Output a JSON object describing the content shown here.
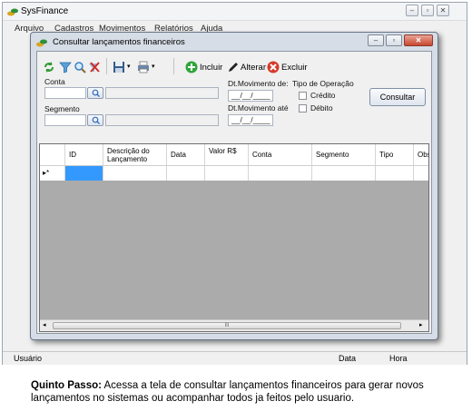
{
  "app": {
    "title": "SysFinance",
    "menu": [
      "Arquivo",
      "Cadastros",
      "Movimentos",
      "Relatórios",
      "Ajuda"
    ],
    "status": {
      "user": "Usuário",
      "date": "Data",
      "time": "Hora"
    }
  },
  "child": {
    "title": "Consultar lançamentos financeiros",
    "toolbar": {
      "incluir": "Incluir",
      "alterar": "Alterar",
      "excluir": "Excluir"
    },
    "filters": {
      "conta_label": "Conta",
      "segmento_label": "Segmento",
      "dt_de_label": "Dt.Movimento de:",
      "dt_ate_label": "Dt.Movimento até",
      "dt_de_value": "__/__/____",
      "dt_ate_value": "__/__/____",
      "tipo_label": "Tipo de Operação",
      "credito": "Crédito",
      "debito": "Débito",
      "consultar": "Consultar"
    },
    "grid": {
      "columns": [
        "ID",
        "Descrição do Lançamento",
        "Data",
        "Valor R$",
        "Conta",
        "Segmento",
        "Tipo",
        "Obse"
      ],
      "row_marker": "▸*",
      "scroll_grip": "III"
    }
  },
  "caption": {
    "label": "Quinto Passo:",
    "text": "Acessa a tela de consultar lançamentos financeiros para gerar novos lançamentos no sistemas ou acompanhar todos ja feitos pelo usuario."
  },
  "colors": {
    "accent": "#3399ff",
    "close": "#c8472f",
    "grid_bg": "#ababab"
  }
}
